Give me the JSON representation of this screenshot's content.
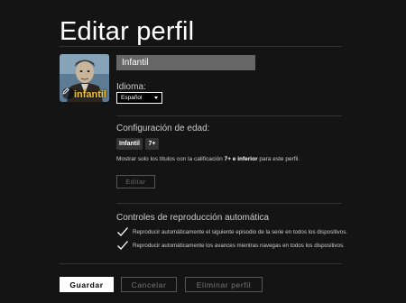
{
  "header": {
    "title": "Editar perfil"
  },
  "profile": {
    "avatar_label": "infantil",
    "name_value": "Infantil"
  },
  "language": {
    "label": "Idioma:",
    "selected": "Español"
  },
  "maturity": {
    "label": "Configuración de edad:",
    "tags": [
      "Infantil",
      "7+"
    ],
    "description_prefix": "Mostrar solo los títulos con la calificación ",
    "description_bold": "7+ e inferior",
    "description_suffix": " para este perfil.",
    "edit_label": "Editar"
  },
  "autoplay": {
    "label": "Controles de reproducción automática",
    "options": [
      "Reproducir automáticamente el siguiente episodio de la serie en todos los dispositivos.",
      "Reproducir automáticamente los avances mientras navegas en todos los dispositivos."
    ]
  },
  "actions": {
    "save_label": "Guardar",
    "cancel_label": "Cancelar",
    "delete_label": "Eliminar perfil"
  },
  "colors": {
    "background": "#141414",
    "avatar_label": "#f4c430"
  }
}
